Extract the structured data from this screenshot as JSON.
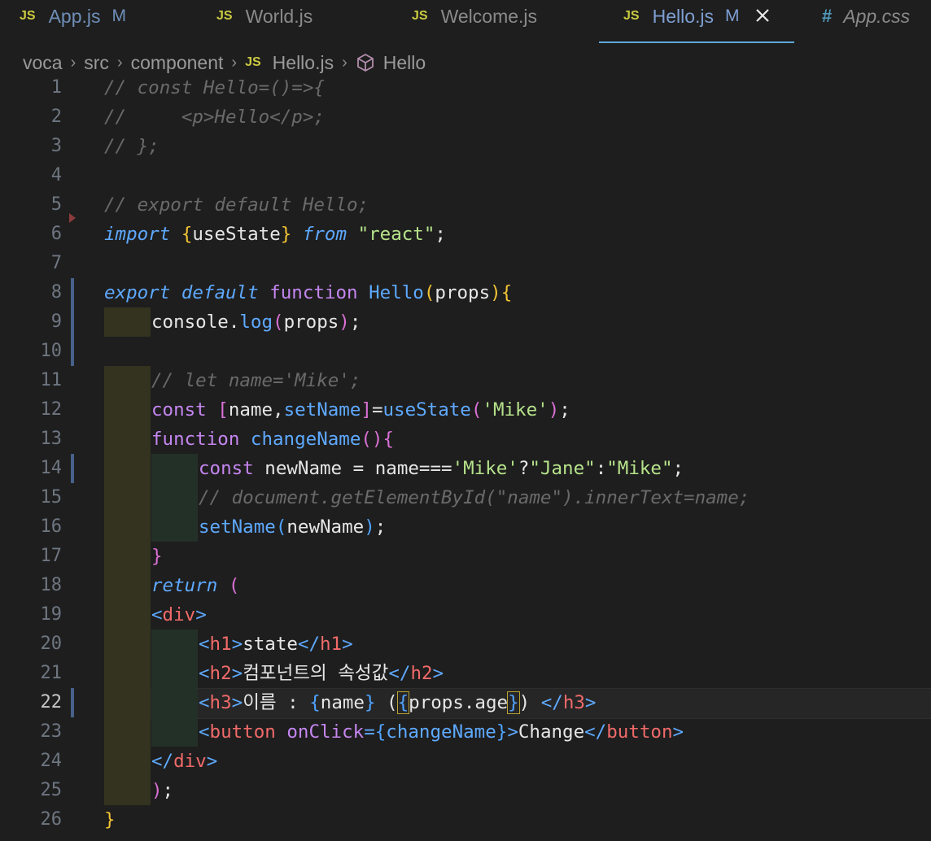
{
  "tabs": [
    {
      "icon": "JS",
      "name": "App.js",
      "badge": "M"
    },
    {
      "icon": "JS",
      "name": "World.js",
      "badge": ""
    },
    {
      "icon": "JS",
      "name": "Welcome.js",
      "badge": ""
    },
    {
      "icon": "JS",
      "name": "Hello.js",
      "badge": "M",
      "active": true
    },
    {
      "icon": "#",
      "name": "App.css",
      "badge": ""
    }
  ],
  "breadcrumb": {
    "items": [
      "voca",
      "src",
      "component",
      "Hello.js",
      "Hello"
    ],
    "file_icon": "JS"
  },
  "editor": {
    "current_line": "22",
    "line_numbers": [
      "1",
      "2",
      "3",
      "4",
      "5",
      "6",
      "7",
      "8",
      "9",
      "10",
      "11",
      "12",
      "13",
      "14",
      "15",
      "16",
      "17",
      "18",
      "19",
      "20",
      "21",
      "22",
      "23",
      "24",
      "25",
      "26"
    ],
    "lines": {
      "l1": "// const Hello=()=>{",
      "l2": "//     <p>Hello</p>;",
      "l3": "// };",
      "l5": "// export default Hello;",
      "l6_import": "import",
      "l6_ob": "{",
      "l6_name": "useState",
      "l6_cb": "}",
      "l6_from": "from",
      "l6_str": "\"react\"",
      "l6_semi": ";",
      "l8_export": "export",
      "l8_default": "default",
      "l8_function": "function",
      "l8_name": "Hello",
      "l8_op": "(",
      "l8_arg": "props",
      "l8_cp": ")",
      "l8_ob": "{",
      "l9_obj": "console",
      "l9_dot": ".",
      "l9_fn": "log",
      "l9_op": "(",
      "l9_arg": "props",
      "l9_cp": ")",
      "l9_semi": ";",
      "l11": "// let name='Mike';",
      "l12_const": "const",
      "l12_ob": "[",
      "l12_a": "name,",
      "l12_b": "setName",
      "l12_cb": "]",
      "l12_eq": "=",
      "l12_fn": "useState",
      "l12_op": "(",
      "l12_str": "'Mike'",
      "l12_cp": ")",
      "l12_semi": ";",
      "l13_function": "function",
      "l13_name": "changeName",
      "l13_parens": "()",
      "l13_ob": "{",
      "l14_const": "const",
      "l14_rest": " newName = name===",
      "l14_s1": "'Mike'",
      "l14_q": "?",
      "l14_s2": "\"Jane\"",
      "l14_c": ":",
      "l14_s3": "\"Mike\"",
      "l14_semi": ";",
      "l15": "// document.getElementById(\"name\").innerText=name;",
      "l16_fn": "setName",
      "l16_op": "(",
      "l16_arg": "newName",
      "l16_cp": ")",
      "l16_semi": ";",
      "l17": "}",
      "l18_return": "return",
      "l18_op": "(",
      "l19_lt": "<",
      "l19_tag": "div",
      "l19_gt": ">",
      "l20_tag": "h1",
      "l20_text": "state",
      "l21_tag": "h2",
      "l21_text": "컴포넌트의 속성값",
      "l22_tag": "h3",
      "l22_text": "이름 : ",
      "l22_ob": "{",
      "l22_var": "name",
      "l22_cb": "}",
      "l22_op": " (",
      "l22_ob2": "{",
      "l22_expr": "props.age",
      "l22_cb2": "}",
      "l22_cp": ") ",
      "l23_tag": "button",
      "l23_attr": "onClick",
      "l23_eq": "=",
      "l23_ob": "{",
      "l23_fn": "changeName",
      "l23_cb": "}",
      "l23_text": "Change",
      "l24_tag": "div",
      "l25_cp": ")",
      "l25_semi": ";",
      "l26": "}"
    }
  }
}
